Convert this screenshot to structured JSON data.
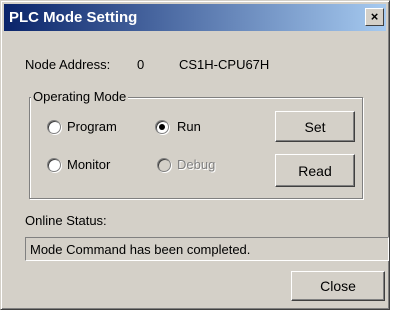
{
  "window": {
    "title": "PLC Mode Setting",
    "close_glyph": "×"
  },
  "node": {
    "address_label": "Node Address:",
    "address_value": "0",
    "cpu_model": "CS1H-CPU67H"
  },
  "operating_mode": {
    "legend": "Operating Mode",
    "options": [
      {
        "label": "Program",
        "selected": false,
        "enabled": true
      },
      {
        "label": "Run",
        "selected": true,
        "enabled": true
      },
      {
        "label": "Monitor",
        "selected": false,
        "enabled": true
      },
      {
        "label": "Debug",
        "selected": false,
        "enabled": false
      }
    ],
    "set_label": "Set",
    "read_label": "Read"
  },
  "status": {
    "label": "Online Status:",
    "message": "Mode Command has been completed."
  },
  "footer": {
    "close_label": "Close"
  },
  "colors": {
    "title_gradient_start": "#0a246a",
    "title_gradient_end": "#a6caf0",
    "dialog_face": "#d4d0c8"
  }
}
